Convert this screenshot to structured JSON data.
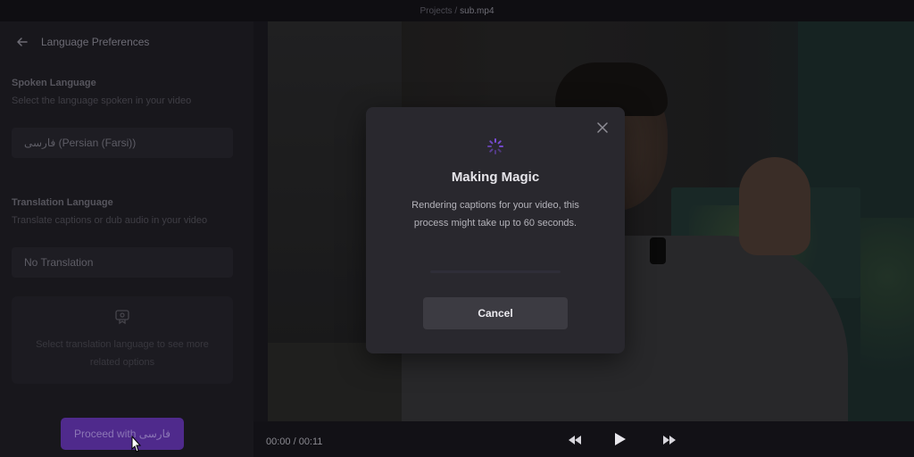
{
  "topbar": {
    "breadcrumb_prefix": "Projects /",
    "file_name": "sub.mp4"
  },
  "sidebar": {
    "title": "Language Preferences",
    "spoken": {
      "title": "Spoken Language",
      "subtitle": "Select the language spoken in your video",
      "value": "فارسی (Persian (Farsi))"
    },
    "translation": {
      "title": "Translation Language",
      "subtitle": "Translate captions or dub audio in your video",
      "value": "No Translation"
    },
    "info_text": "Select translation language to see more related options",
    "proceed_label": "Proceed with فارسی"
  },
  "player": {
    "time": "00:00 / 00:11"
  },
  "modal": {
    "title": "Making Magic",
    "body": "Rendering captions for your video, this process might take up to 60 seconds.",
    "cancel_label": "Cancel",
    "progress": 0.0
  },
  "colors": {
    "accent": "#4f2a8c",
    "spinner": "#7c4ddb"
  }
}
